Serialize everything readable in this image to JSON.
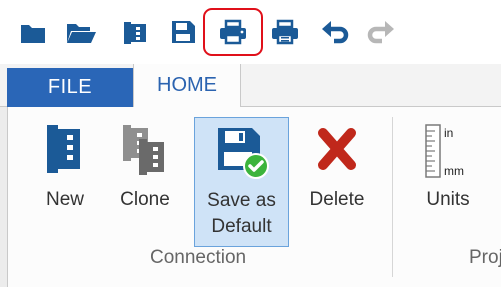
{
  "quick_access": {
    "items": [
      {
        "name": "open-project-icon",
        "color": "#1b5a97"
      },
      {
        "name": "open-folder-icon",
        "color": "#1b5a97"
      },
      {
        "name": "connection-icon",
        "color": "#1b5a97"
      },
      {
        "name": "save-icon",
        "color": "#1b5a97"
      },
      {
        "name": "print-icon",
        "color": "#1b5a97",
        "highlighted": true
      },
      {
        "name": "print-preview-icon",
        "color": "#1b5a97"
      },
      {
        "name": "undo-icon",
        "color": "#1b5a97"
      },
      {
        "name": "redo-icon",
        "color": "#b7b7b7",
        "disabled": true
      }
    ],
    "highlight_color": "#e0101a"
  },
  "tabs": [
    {
      "label": "FILE",
      "active": false
    },
    {
      "label": "HOME",
      "active": true
    }
  ],
  "ribbon": {
    "buttons": [
      {
        "label": "New",
        "icon": "new-connection-icon"
      },
      {
        "label": "Clone",
        "icon": "clone-connection-icon"
      },
      {
        "label": "Save as\nDefault",
        "icon": "save-as-default-icon",
        "selected": true
      },
      {
        "label": "Delete",
        "icon": "delete-icon"
      },
      {
        "label": "Units",
        "icon": "units-ruler-icon",
        "icon_labels": [
          "in",
          "mm"
        ]
      }
    ],
    "groups": [
      "Connection",
      "Proj"
    ]
  },
  "colors": {
    "accent_blue": "#2a66b7",
    "icon_blue": "#1b5a97",
    "delete_red": "#c0281b",
    "check_green": "#3cb43c",
    "selected_bg": "#cfe3f7"
  }
}
